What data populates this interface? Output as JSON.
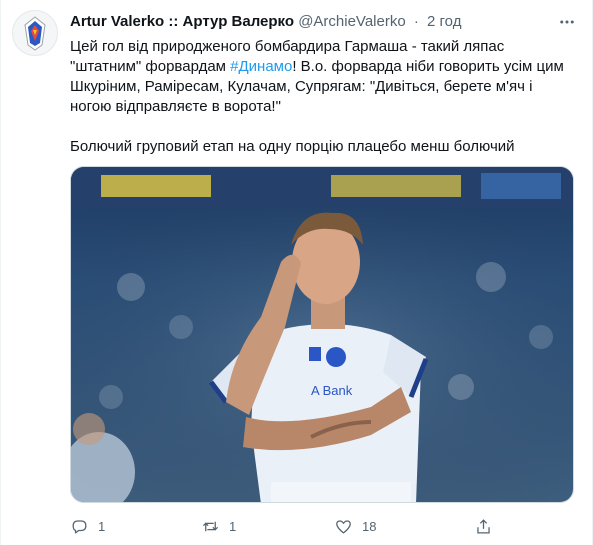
{
  "tweet": {
    "display_name": "Artur Valerko :: Артур Валерко",
    "handle": "@ArchieValerko",
    "separator": "·",
    "time": "2 год",
    "text": {
      "line1": "Цей гол від природженого бомбардира Гармаша - такий ляпас",
      "line2_before": "\"штатним\" форвардам ",
      "hashtag": "#Динамо",
      "line2_after": "! В.о. форварда ніби говорить усім цим",
      "line3": "Шкуріним, Рамiресам, Кулачам, Супрягам: \"Дивіться, берете м'яч і",
      "line4": "ногою відправляєте в ворота!\"",
      "paragraph2": "Болючий груповий етап на одну порцію плацебо менш болючий"
    },
    "media": {
      "description_icon": "photo",
      "jersey_text": "A Bank"
    },
    "actions": {
      "reply_count": "1",
      "retweet_count": "1",
      "like_count": "18",
      "share_count": ""
    }
  },
  "colors": {
    "accent": "#1d9bf0",
    "secondary_text": "#536471",
    "primary_text": "#0f1419"
  },
  "icons": [
    "more-icon",
    "reply-icon",
    "retweet-icon",
    "like-icon",
    "share-icon"
  ]
}
